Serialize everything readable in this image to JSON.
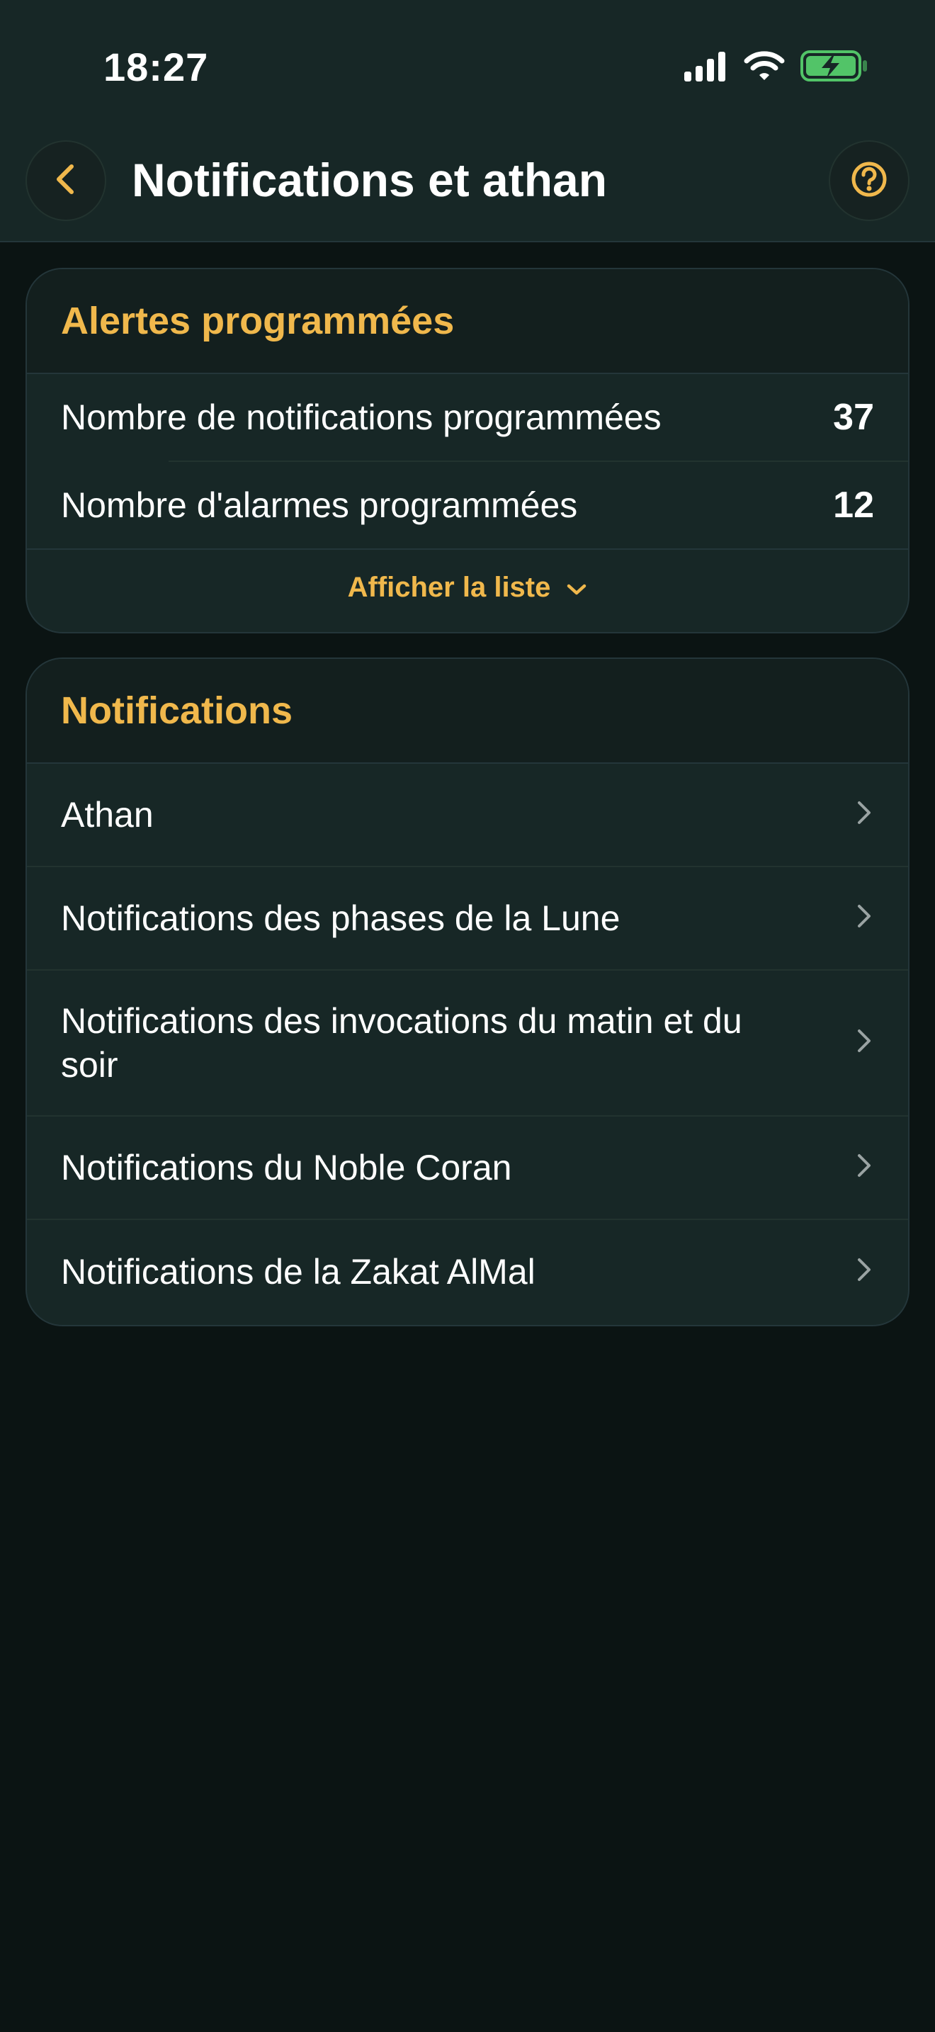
{
  "status_bar": {
    "time": "18:27",
    "icons": [
      "signal-icon",
      "wifi-icon",
      "battery-charging-icon"
    ],
    "battery_color": "#52c468"
  },
  "header": {
    "back_icon": "chevron-left-icon",
    "title": "Notifications et athan",
    "help_icon": "question-circle-icon"
  },
  "colors": {
    "accent": "#f0b84c",
    "background": "#0b1413",
    "card": "#172726"
  },
  "scheduled_alerts": {
    "title": "Alertes programmées",
    "rows": [
      {
        "label": "Nombre de notifications programmées",
        "value": "37"
      },
      {
        "label": "Nombre d'alarmes programmées",
        "value": "12"
      }
    ],
    "show_list_label": "Afficher la liste",
    "show_list_icon": "chevron-down-icon"
  },
  "notifications": {
    "title": "Notifications",
    "items": [
      {
        "label": "Athan"
      },
      {
        "label": "Notifications des phases de la Lune"
      },
      {
        "label": "Notifications des invocations du matin et du soir"
      },
      {
        "label": "Notifications du Noble Coran"
      },
      {
        "label": "Notifications de la Zakat AlMal"
      }
    ],
    "item_icon": "chevron-right-icon"
  }
}
